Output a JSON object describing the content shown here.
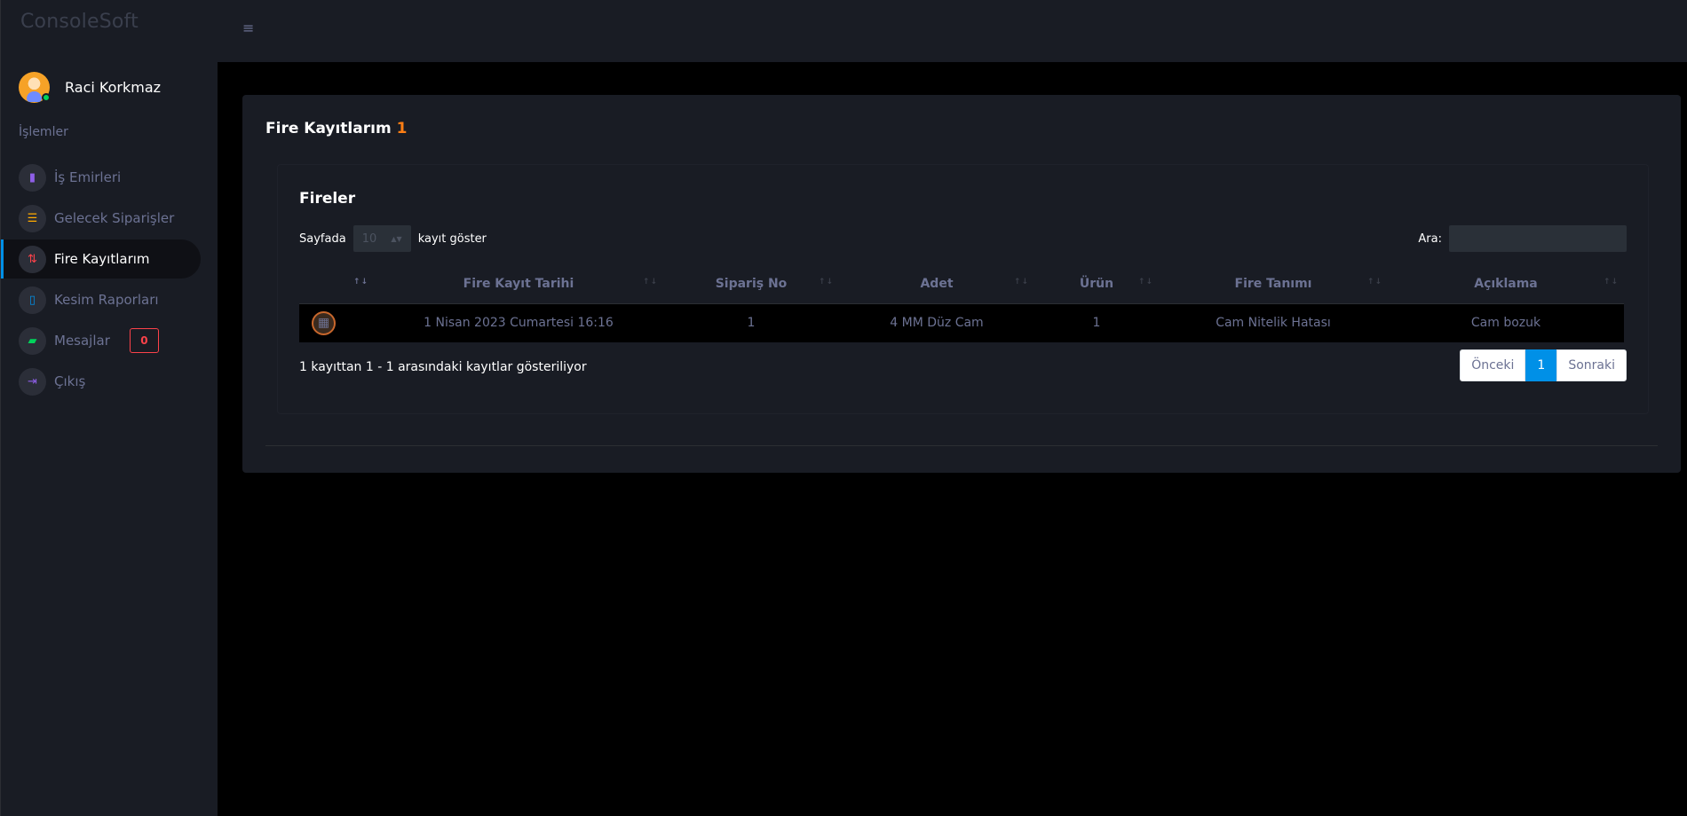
{
  "brand": "ConsoleSoft",
  "user": {
    "name": "Raci Korkmaz"
  },
  "sidebar": {
    "section_label": "İşlemler",
    "items": [
      {
        "label": "İş Emirleri",
        "icon": "book-icon",
        "color": "#8f5fe8",
        "glyph": "▮"
      },
      {
        "label": "Gelecek Siparişler",
        "icon": "list-icon",
        "color": "#ffab00",
        "glyph": "☰"
      },
      {
        "label": "Fire Kayıtlarım",
        "icon": "sort-icon",
        "color": "#fc424a",
        "glyph": "⇅",
        "active": true
      },
      {
        "label": "Kesim Raporları",
        "icon": "ruler-icon",
        "color": "#0090e7",
        "glyph": "▯"
      },
      {
        "label": "Mesajlar",
        "icon": "chat-icon",
        "color": "#00d25b",
        "glyph": "▰",
        "badge": "0"
      },
      {
        "label": "Çıkış",
        "icon": "logout-icon",
        "color": "#8f5fe8",
        "glyph": "⇥"
      }
    ]
  },
  "topbar": {
    "menu_icon": "menu-icon"
  },
  "card": {
    "title": "Fire Kayıtlarım",
    "title_count": "1",
    "inner_title": "Fireler",
    "length": {
      "prefix": "Sayfada",
      "value": "10",
      "suffix": "kayıt göster"
    },
    "search": {
      "label": "Ara:",
      "value": ""
    },
    "table": {
      "columns": [
        "",
        "Fire Kayıt Tarihi",
        "Sipariş No",
        "Adet",
        "Ürün",
        "Fire Tanımı",
        "Açıklama"
      ],
      "rows": [
        [
          "",
          "1 Nisan 2023 Cumartesi 16:16",
          "1",
          "4 MM Düz Cam",
          "1",
          "Cam Nitelik Hatası",
          "Cam bozuk"
        ]
      ]
    },
    "info": "1 kayıttan 1 - 1 arasındaki kayıtlar gösteriliyor",
    "pagination": {
      "prev": "Önceki",
      "current": "1",
      "next": "Sonraki"
    }
  }
}
